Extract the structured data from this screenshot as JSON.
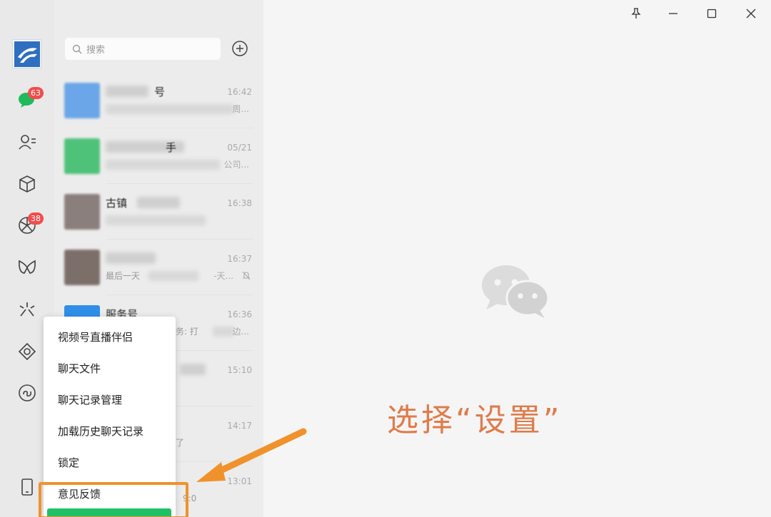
{
  "search": {
    "placeholder": "搜索"
  },
  "rail": {
    "badges": {
      "chat": "63",
      "moments": "38"
    }
  },
  "conversations": [
    {
      "name": "号",
      "time": "16:42",
      "tail": "周..."
    },
    {
      "name": "手",
      "time": "05/21",
      "tail": "公司..."
    },
    {
      "name": "古镇",
      "time": "16:38",
      "tail": ""
    },
    {
      "name": "",
      "time": "16:37",
      "preview": "最后一天",
      "tail": "-天..."
    },
    {
      "name": "服务号",
      "time": "16:36",
      "preview": "务: 打",
      "tail": "边..."
    },
    {
      "name": "",
      "time": "15:10",
      "tail": ""
    },
    {
      "name": "",
      "time": "14:17",
      "preview": "了",
      "tail": ""
    },
    {
      "name": "",
      "time": "13:01",
      "preview": "9:0",
      "tail": ""
    }
  ],
  "menu": {
    "items": [
      "视频号直播伴侣",
      "聊天文件",
      "聊天记录管理",
      "加载历史聊天记录",
      "锁定",
      "意见反馈"
    ]
  },
  "annotation": {
    "text": "选择“设置”"
  },
  "colors": {
    "accent": "#20c064",
    "annotation": "#e07b4a",
    "highlight_box": "#f0922b",
    "badge": "#f24c4c"
  }
}
